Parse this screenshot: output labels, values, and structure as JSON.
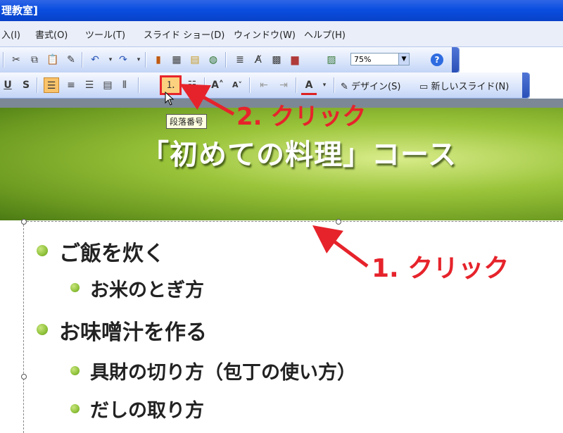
{
  "window": {
    "title": "理教室]"
  },
  "menu": [
    {
      "id": "insert",
      "label": "入(I)"
    },
    {
      "id": "format",
      "label": "書式(O)"
    },
    {
      "id": "tools",
      "label": "ツール(T)"
    },
    {
      "id": "slideshow",
      "label": "スライド ショー(D)"
    },
    {
      "id": "window",
      "label": "ウィンドウ(W)"
    },
    {
      "id": "help",
      "label": "ヘルプ(H)"
    }
  ],
  "toolbar_standard": {
    "zoom": "75%",
    "help_icon": "?"
  },
  "toolbar_format": {
    "underline": "U",
    "shadow": "S",
    "numbered_list_icon": "numbered-list",
    "font_color": "A",
    "design_label": "デザイン(S)",
    "new_slide_label": "新しいスライド(N)"
  },
  "tooltip": "段落番号",
  "annotations": {
    "step2": "2. クリック",
    "step1": "1. クリック"
  },
  "slide": {
    "title": "「初めての料理」コース",
    "bullets": [
      {
        "level": 1,
        "text": "ご飯を炊く"
      },
      {
        "level": 2,
        "text": "お米のとぎ方"
      },
      {
        "level": 1,
        "text": "お味噌汁を作る"
      },
      {
        "level": 2,
        "text": "具財の切り方（包丁の使い方）"
      },
      {
        "level": 2,
        "text": "だしの取り方"
      }
    ]
  },
  "colors": {
    "titlebar": "#0a4ee0",
    "annotation": "#e6232b",
    "banner": "#9ac43a",
    "bullet": "#8fc23a"
  }
}
